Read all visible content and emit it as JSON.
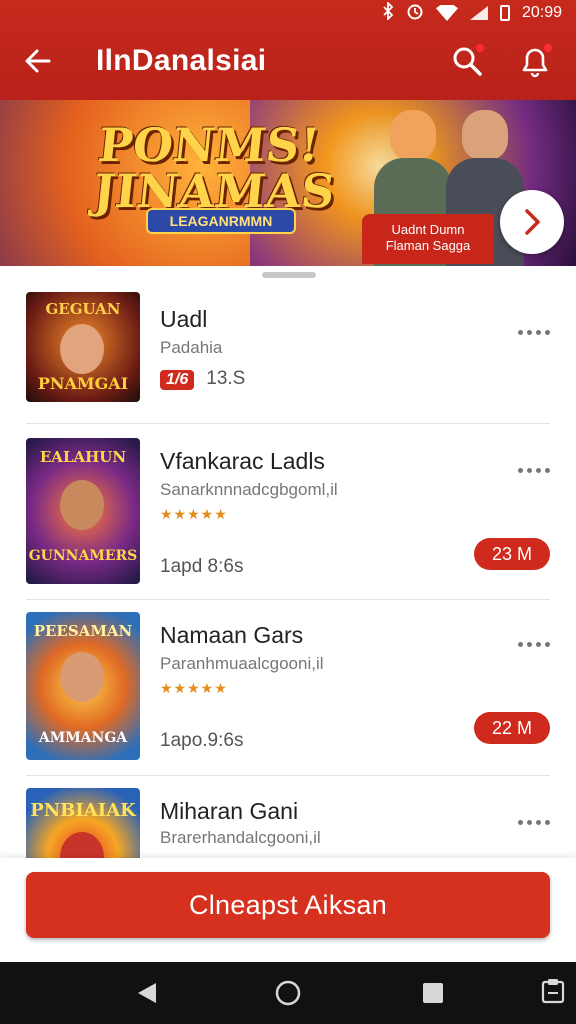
{
  "status_bar": {
    "time": "20:99"
  },
  "app_bar": {
    "title": "IlnDanalsiai"
  },
  "banner": {
    "title_line1": "PONMS!",
    "title_line2": "JINAMAS",
    "tagline": "LEAGANRMMN",
    "card_line1": "Uadnt Dumn",
    "card_line2": "Flaman Sagga"
  },
  "apps": [
    {
      "thumb_top": "GEGUAN",
      "thumb_bottom": "PNAMGAI",
      "name": "Uadl",
      "developer": "Padahia",
      "badge": "1/6",
      "meta": "13.S",
      "stars": "",
      "size": ""
    },
    {
      "thumb_top": "EALAHUN",
      "thumb_bottom": "GUNNAMERS",
      "name": "Vfankarac Ladls",
      "developer": "Sanarknnnadcgbgoml,il",
      "badge": "",
      "stars": "★★★★★",
      "meta": "1apd 8:6s",
      "size": "23 M"
    },
    {
      "thumb_top": "PEESAMAN",
      "thumb_bottom": "AMMANGA",
      "name": "Namaan Gars",
      "developer": "Paranhmuaalcgooni,il",
      "badge": "",
      "stars": "★★★★★",
      "meta": "1apo.9:6s",
      "size": "22 M"
    },
    {
      "thumb_top": "PNBIAIAK",
      "thumb_bottom": "",
      "name": "Miharan Gani",
      "developer": "Brarerhandalcgooni,il",
      "badge": "",
      "stars": "",
      "meta": "",
      "size": ""
    }
  ],
  "cta": {
    "label": "Clneapst Aiksan"
  },
  "colors": {
    "accent": "#c72a1c",
    "star": "#e48b1a",
    "nav": "#111111"
  }
}
